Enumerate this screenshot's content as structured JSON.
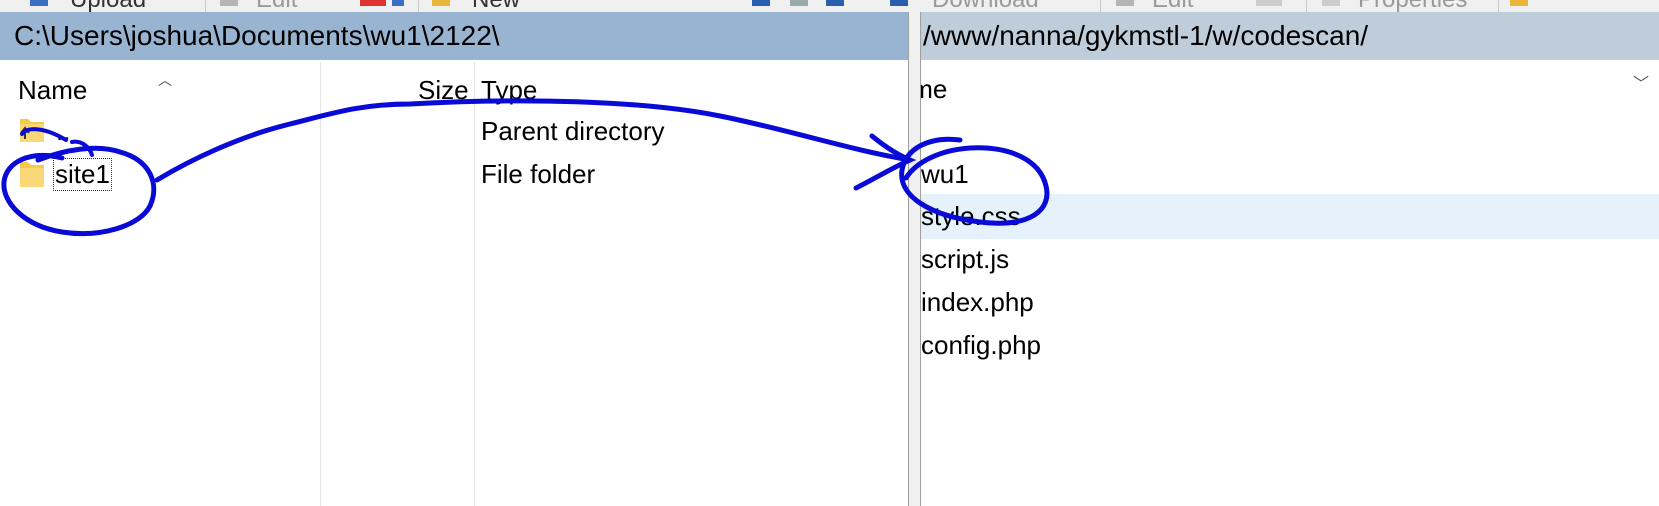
{
  "toolbar": {
    "upload_label": "Upload",
    "edit_left_label": "Edit",
    "new_label": "New",
    "download_label": "Download",
    "edit_right_label": "Edit",
    "properties_label": "Properties"
  },
  "local_pane": {
    "path": "C:\\Users\\joshua\\Documents\\wu1\\2122\\",
    "columns": {
      "name": "Name",
      "size": "Size",
      "type": "Type"
    },
    "rows": [
      {
        "name": "..",
        "size": "",
        "type": "Parent directory",
        "icon": "parent-folder-icon"
      },
      {
        "name": "site1",
        "size": "",
        "type": "File folder",
        "icon": "folder-icon"
      }
    ]
  },
  "remote_pane": {
    "path": "/www/nanna/gykmstl-1/w/codescan/",
    "columns": {
      "name": "Name"
    },
    "rows": [
      {
        "name": "",
        "icon": "parent-folder-icon"
      },
      {
        "name": "wu1",
        "icon": "folder-icon"
      },
      {
        "name": "style.css",
        "icon": "file-icon"
      },
      {
        "name": "script.js",
        "icon": "file-icon"
      },
      {
        "name": "index.php",
        "icon": "vscode-icon"
      },
      {
        "name": "config.php",
        "icon": "vscode-icon"
      }
    ]
  },
  "colors": {
    "local_path_bg": "#99b4d1",
    "remote_path_bg": "#bfcddb",
    "selected_row": "#e5f1fb",
    "annotation_ink": "#0a0ad8",
    "folder_yellow": "#f6c84c"
  }
}
